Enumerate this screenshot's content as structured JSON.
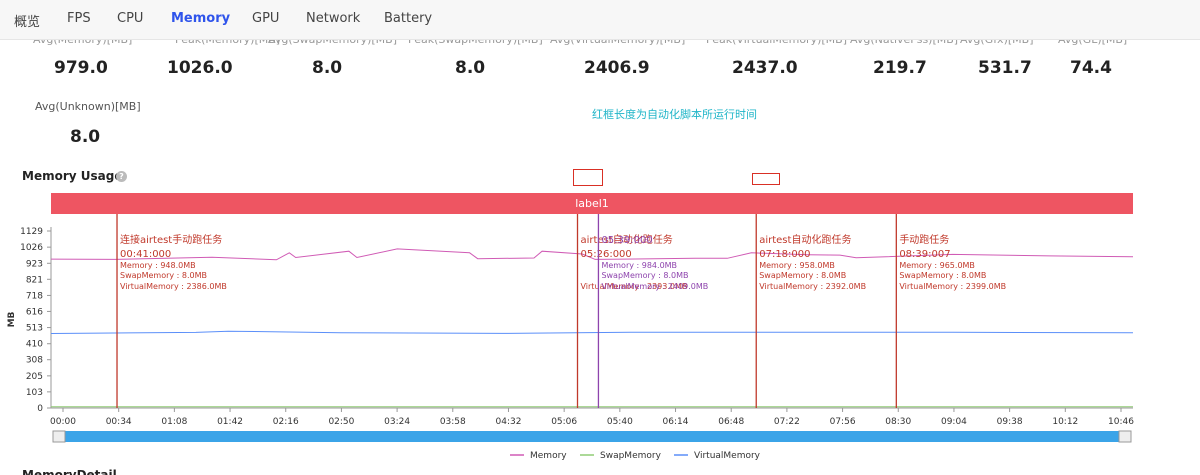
{
  "nav": {
    "tabs": [
      {
        "label": "概览",
        "active": false
      },
      {
        "label": "FPS",
        "active": false
      },
      {
        "label": "CPU",
        "active": false
      },
      {
        "label": "Memory",
        "active": true
      },
      {
        "label": "GPU",
        "active": false
      },
      {
        "label": "Network",
        "active": false
      },
      {
        "label": "Battery",
        "active": false
      }
    ]
  },
  "stats": {
    "row1": [
      {
        "label": "Avg(Memory)[MB]",
        "value": "979.0"
      },
      {
        "label": "Peak(Memory)[MB]",
        "value": "1026.0"
      },
      {
        "label": "Avg(SwapMemory)[MB]",
        "value": "8.0"
      },
      {
        "label": "Peak(SwapMemory)[MB]",
        "value": "8.0"
      },
      {
        "label": "Avg(VirtualMemory)[MB]",
        "value": "2406.9"
      },
      {
        "label": "Peak(VirtualMemory)[MB]",
        "value": "2437.0"
      },
      {
        "label": "Avg(NativePss)[MB]",
        "value": "219.7"
      },
      {
        "label": "Avg(Gfx)[MB]",
        "value": "531.7"
      },
      {
        "label": "Avg(GL)[MB]",
        "value": "74.4"
      }
    ],
    "row2": {
      "label": "Avg(Unknown)[MB]",
      "value": "8.0"
    }
  },
  "annotation": "红框长度为自动化脚本所运行时间",
  "section_title": "Memory Usage",
  "footer_title": "MemoryDetail",
  "colors": {
    "memory": "#d05bb5",
    "swap": "#91cc75",
    "virtual": "#5b8ff9",
    "marker_red": "#c0392b",
    "marker_purple": "#8e44ad",
    "labelbar": "#ee5562",
    "slider": "#3ba4e8"
  },
  "chart_data": {
    "type": "line",
    "ylabel": "MB",
    "label_bar": "label1",
    "y_ticks": [
      0,
      103,
      205,
      308,
      410,
      513,
      616,
      718,
      821,
      923,
      1026,
      1129
    ],
    "ylim": [
      0,
      1129
    ],
    "x_ticks": [
      "00:00",
      "00:34",
      "01:08",
      "01:42",
      "02:16",
      "02:50",
      "03:24",
      "03:58",
      "04:32",
      "05:06",
      "05:40",
      "06:14",
      "06:48",
      "07:22",
      "07:56",
      "08:30",
      "09:04",
      "09:38",
      "10:12",
      "10:46"
    ],
    "xlim_seconds": [
      0,
      672
    ],
    "series": [
      {
        "name": "Memory",
        "points": [
          [
            0,
            950
          ],
          [
            40,
            948
          ],
          [
            100,
            962
          ],
          [
            140,
            945
          ],
          [
            148,
            990
          ],
          [
            152,
            960
          ],
          [
            185,
            1000
          ],
          [
            190,
            960
          ],
          [
            215,
            1015
          ],
          [
            260,
            990
          ],
          [
            265,
            952
          ],
          [
            300,
            957
          ],
          [
            305,
            1000
          ],
          [
            330,
            982
          ],
          [
            338,
            948
          ],
          [
            400,
            955
          ],
          [
            420,
            955
          ],
          [
            435,
            990
          ],
          [
            470,
            978
          ],
          [
            490,
            975
          ],
          [
            500,
            958
          ],
          [
            560,
            980
          ],
          [
            620,
            970
          ],
          [
            672,
            965
          ]
        ]
      },
      {
        "name": "SwapMemory",
        "points": [
          [
            0,
            8
          ],
          [
            672,
            8
          ]
        ]
      },
      {
        "name": "VirtualMemory",
        "points": [
          [
            0,
            475
          ],
          [
            30,
            478
          ],
          [
            90,
            482
          ],
          [
            110,
            490
          ],
          [
            180,
            480
          ],
          [
            280,
            476
          ],
          [
            360,
            483
          ],
          [
            420,
            483
          ],
          [
            470,
            483
          ],
          [
            560,
            483
          ],
          [
            672,
            480
          ]
        ]
      }
    ],
    "markers": [
      {
        "x_seconds": 41,
        "title": "连接airtest手动跑任务",
        "time": "00:41:000",
        "memory": "948.0MB",
        "swap": "8.0MB",
        "virtual": "2386.0MB",
        "color": "red"
      },
      {
        "x_seconds": 327,
        "title": "airtest自动化跑任务",
        "time": "05:26:000",
        "memory": "",
        "swap": "",
        "virtual": "2393.0MB",
        "color": "red"
      },
      {
        "x_seconds": 340,
        "title": "05:39:000",
        "time": "",
        "memory": "984.0MB",
        "swap": "8.0MB",
        "virtual": "2409.0MB",
        "color": "purple"
      },
      {
        "x_seconds": 438,
        "title": "airtest自动化跑任务",
        "time": "07:18:000",
        "memory": "958.0MB",
        "swap": "8.0MB",
        "virtual": "2392.0MB",
        "color": "red"
      },
      {
        "x_seconds": 525,
        "title": "手动跑任务",
        "time": "08:39:007",
        "memory": "965.0MB",
        "swap": "8.0MB",
        "virtual": "2399.0MB",
        "color": "red"
      }
    ],
    "marker_field_labels": {
      "memory": "Memory",
      "swap": "SwapMemory",
      "virtual": "VirtualMemory"
    },
    "legend": [
      {
        "name": "Memory",
        "color_key": "memory"
      },
      {
        "name": "SwapMemory",
        "color_key": "swap"
      },
      {
        "name": "VirtualMemory",
        "color_key": "virtual"
      }
    ],
    "legend_position": "bottom-center",
    "grid": false
  }
}
